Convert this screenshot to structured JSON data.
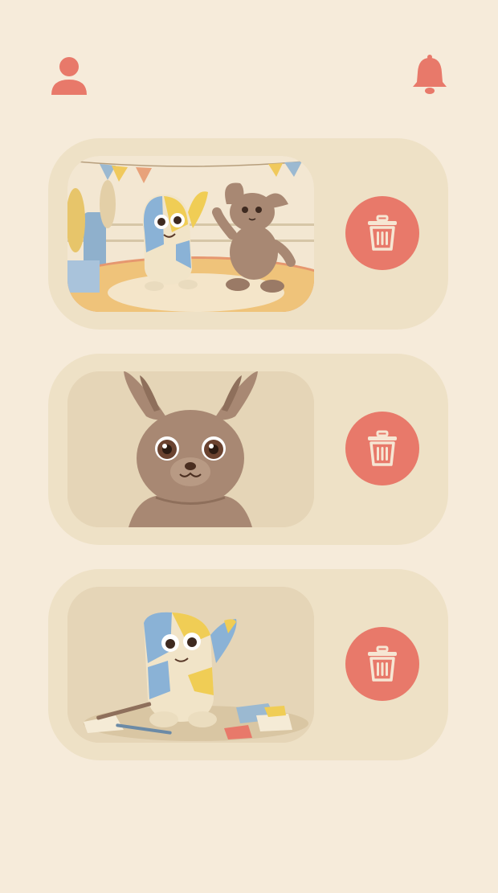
{
  "header": {
    "profile_icon": "person-icon",
    "notifications_icon": "bell-icon"
  },
  "colors": {
    "background": "#F6EBDA",
    "card": "#EEE1C6",
    "thumbnail_bg": "#E5D5B7",
    "accent": "#E8796A",
    "icon_light": "#F6E6D3"
  },
  "items": [
    {
      "thumbnail": "painted-monster-and-bunny-dancing-image",
      "action_icon": "trash-icon"
    },
    {
      "thumbnail": "brown-bunny-portrait-image",
      "action_icon": "trash-icon"
    },
    {
      "thumbnail": "paint-splattered-monster-image",
      "action_icon": "trash-icon"
    }
  ]
}
